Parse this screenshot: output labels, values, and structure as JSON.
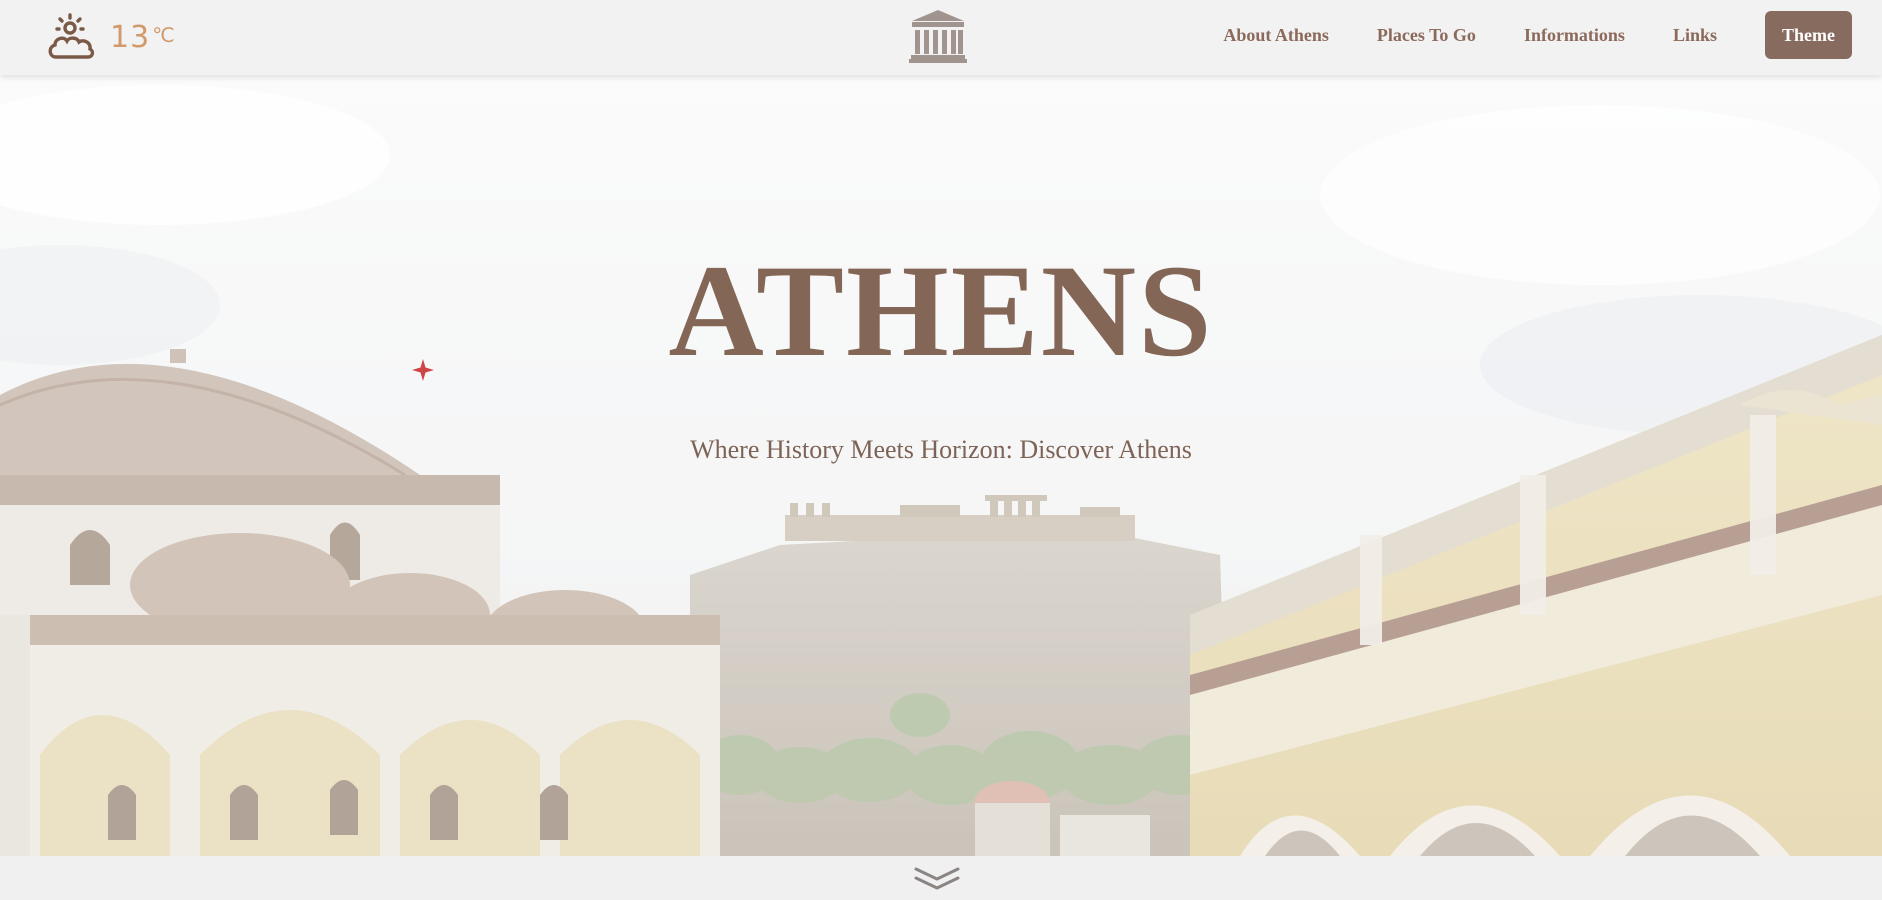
{
  "weather": {
    "icon": "partly-cloudy-icon",
    "temperature": "13",
    "unit": "℃"
  },
  "logo": {
    "icon": "greek-temple-icon"
  },
  "nav": {
    "items": [
      {
        "label": "About Athens"
      },
      {
        "label": "Places To Go"
      },
      {
        "label": "Informations"
      },
      {
        "label": "Links"
      }
    ],
    "theme_label": "Theme"
  },
  "hero": {
    "title": "ATHENS",
    "subtitle": "Where History Meets Horizon: Discover Athens",
    "background": "photo-monastiraki-square-acropolis"
  },
  "scroll": {
    "icon": "double-chevron-down-icon"
  },
  "colors": {
    "brand_brown": "#846657",
    "button_bg": "#876b5e",
    "nav_text": "#8b6a5c",
    "weather_text": "#d29a6b",
    "bar_bg": "#f2f2f2"
  }
}
